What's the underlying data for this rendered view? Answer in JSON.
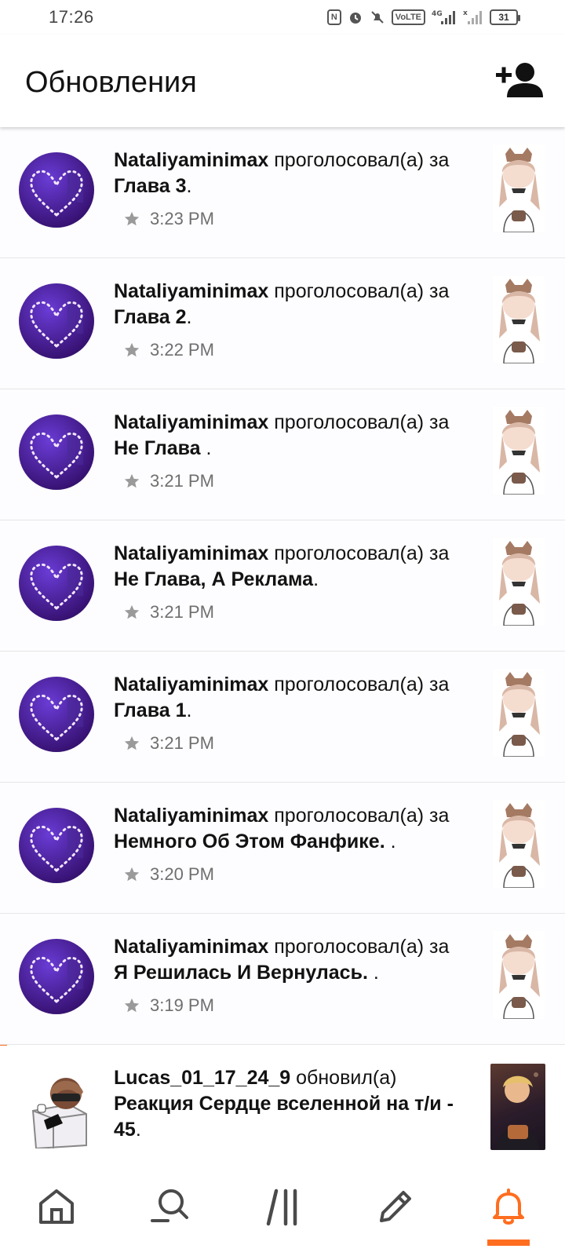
{
  "status_bar": {
    "time": "17:26",
    "icons": [
      "nfc-icon",
      "alarm-icon",
      "mute-icon",
      "volte-icon",
      "4g-signal-icon",
      "no-signal-icon",
      "battery-icon"
    ],
    "volte": "VoLTE",
    "network": "4G",
    "battery": "31"
  },
  "header": {
    "title": "Обновления",
    "action_icon": "add-user-icon"
  },
  "colors": {
    "accent": "#ff6d1f",
    "text": "#121212",
    "meta": "#6f6f6f"
  },
  "feed": {
    "items": [
      {
        "user": "Nataliyaminimax",
        "action": " проголосовал(а) за ",
        "title": "Глава 3",
        "suffix": ".",
        "time": "3:23 PM"
      },
      {
        "user": "Nataliyaminimax",
        "action": " проголосовал(а) за ",
        "title": "Глава 2",
        "suffix": ".",
        "time": "3:22 PM"
      },
      {
        "user": "Nataliyaminimax",
        "action": " проголосовал(а) за ",
        "title": "Не Глава ",
        "suffix": ".",
        "time": "3:21 PM"
      },
      {
        "user": "Nataliyaminimax",
        "action": " проголосовал(а) за ",
        "title": "Не Глава, А Реклама",
        "suffix": ".",
        "time": "3:21 PM"
      },
      {
        "user": "Nataliyaminimax",
        "action": " проголосовал(а) за ",
        "title": "Глава 1",
        "suffix": ".",
        "time": "3:21 PM"
      },
      {
        "user": "Nataliyaminimax",
        "action": " проголосовал(а) за ",
        "title": "Немного Об Этом Фанфике. ",
        "suffix": ".",
        "time": "3:20 PM"
      },
      {
        "user": "Nataliyaminimax",
        "action": " проголосовал(а) за ",
        "title": "Я Решилась И Вернулась. ",
        "suffix": ".",
        "time": "3:19 PM"
      }
    ],
    "last_item": {
      "user": "Lucas_01_17_24_9",
      "action": " обновил(а) ",
      "title": "Реакция Сердце вселенной на т/и - 45",
      "suffix": "."
    }
  },
  "bottom_nav": {
    "items": [
      {
        "icon": "home-icon",
        "active": false
      },
      {
        "icon": "search-icon",
        "active": false
      },
      {
        "icon": "library-icon",
        "active": false
      },
      {
        "icon": "write-pencil-icon",
        "active": false
      },
      {
        "icon": "bell-icon",
        "active": true
      }
    ]
  }
}
